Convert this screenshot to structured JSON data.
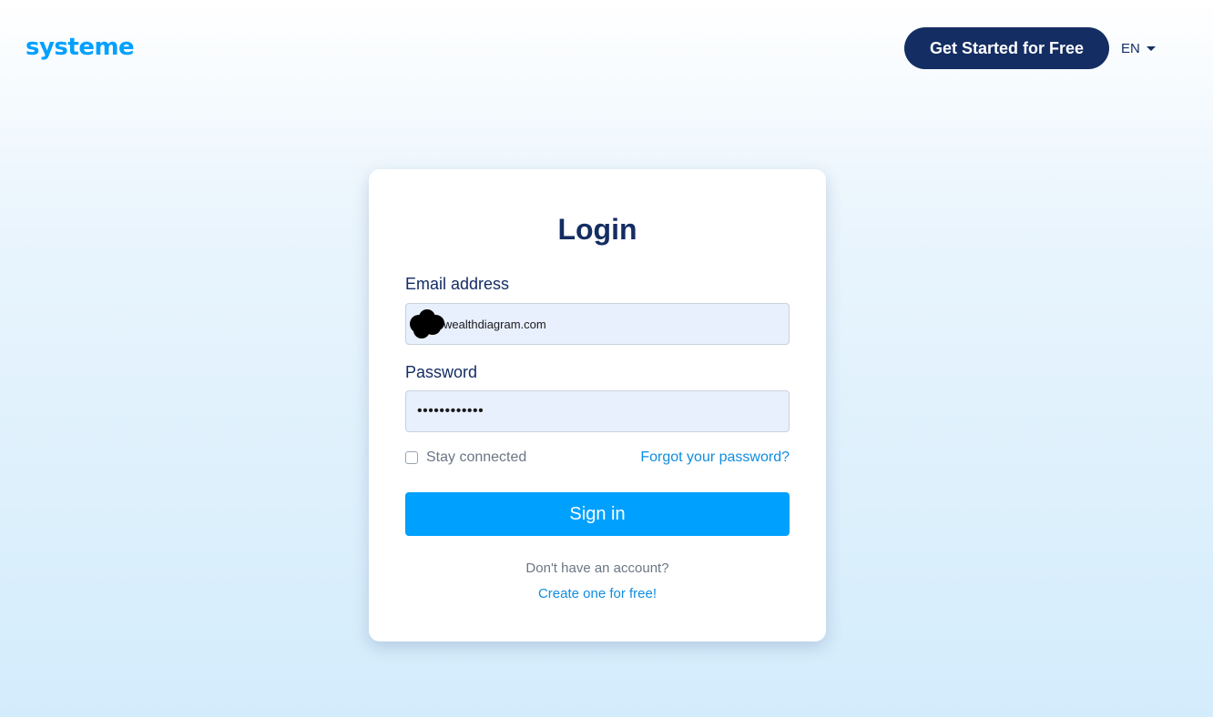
{
  "header": {
    "logo_text": "systeme",
    "cta_label": "Get Started for Free",
    "language": "EN"
  },
  "login": {
    "title": "Login",
    "email_label": "Email address",
    "email_value": "wealthdiagram.com",
    "password_label": "Password",
    "password_value": "••••••••••••",
    "stay_connected_label": "Stay connected",
    "stay_connected_checked": false,
    "forgot_password_label": "Forgot your password?",
    "signin_label": "Sign in",
    "no_account_text": "Don't have an account?",
    "create_account_label": "Create one for free!"
  },
  "colors": {
    "brand": "#00a0ff",
    "navy": "#142d63",
    "link": "#0f8de0",
    "input_bg": "#e8f0fe"
  }
}
